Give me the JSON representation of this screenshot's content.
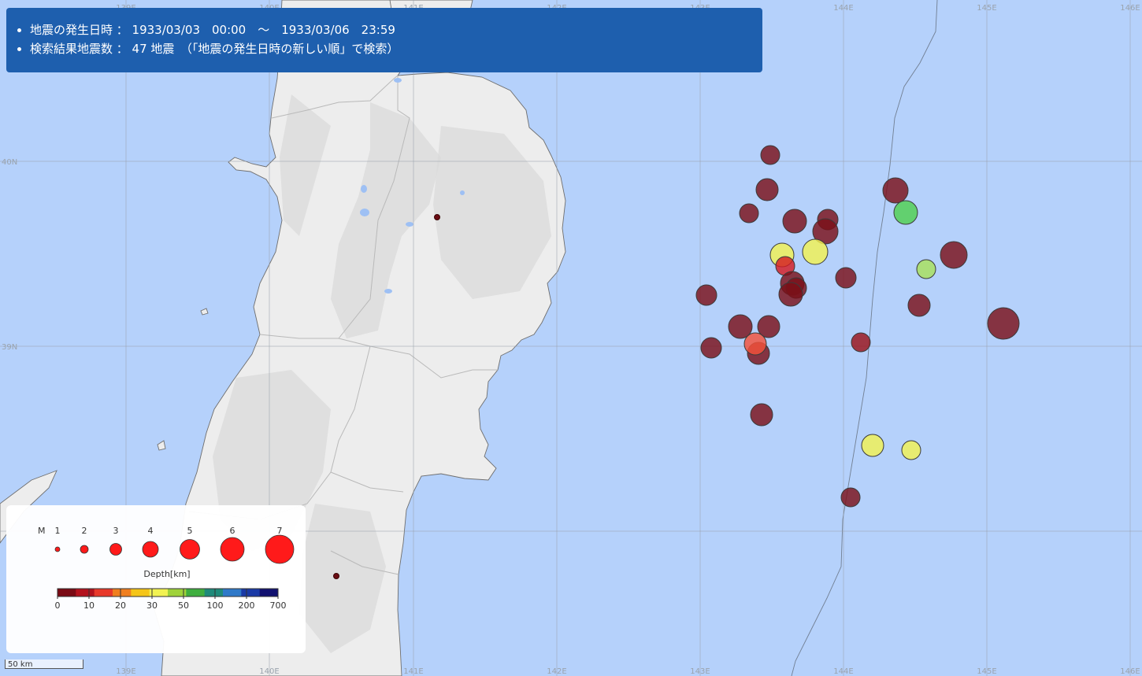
{
  "info": {
    "line1": "地震の発生日時 ： 1933/03/03　00:00　～　1933/03/06　23:59",
    "line2": "検索結果地震数 ： 47 地震　（「地震の発生日時の新しい順」で検索）"
  },
  "axes": {
    "lon_labels": [
      "139E",
      "140E",
      "141E",
      "142E",
      "143E",
      "144E",
      "145E",
      "146E"
    ],
    "lat_labels": [
      "40N",
      "39N"
    ]
  },
  "legend": {
    "magnitude_title": "M",
    "magnitudes": [
      "1",
      "2",
      "3",
      "4",
      "5",
      "6",
      "7"
    ],
    "depth_title": "Depth[km]",
    "depth_ticks": [
      "0",
      "10",
      "20",
      "30",
      "50",
      "100",
      "200",
      "700"
    ],
    "depth_colors": [
      "#7a0a14",
      "#b3121d",
      "#e8392a",
      "#f07f1f",
      "#f5c518",
      "#f2f252",
      "#9fd23a",
      "#3fae3f",
      "#1f8a7a",
      "#2f79c8",
      "#1a3aa6",
      "#111170"
    ],
    "symbol_color": "#ff1a1a"
  },
  "scale_bar": {
    "label": "50 km"
  },
  "quake_colors": {
    "very_shallow": "#7a1018",
    "shallow": "#d41b22",
    "mid": "#f4523a",
    "yellow": "#f2f252",
    "lime": "#a8e05a",
    "green": "#4fcf4f"
  }
}
